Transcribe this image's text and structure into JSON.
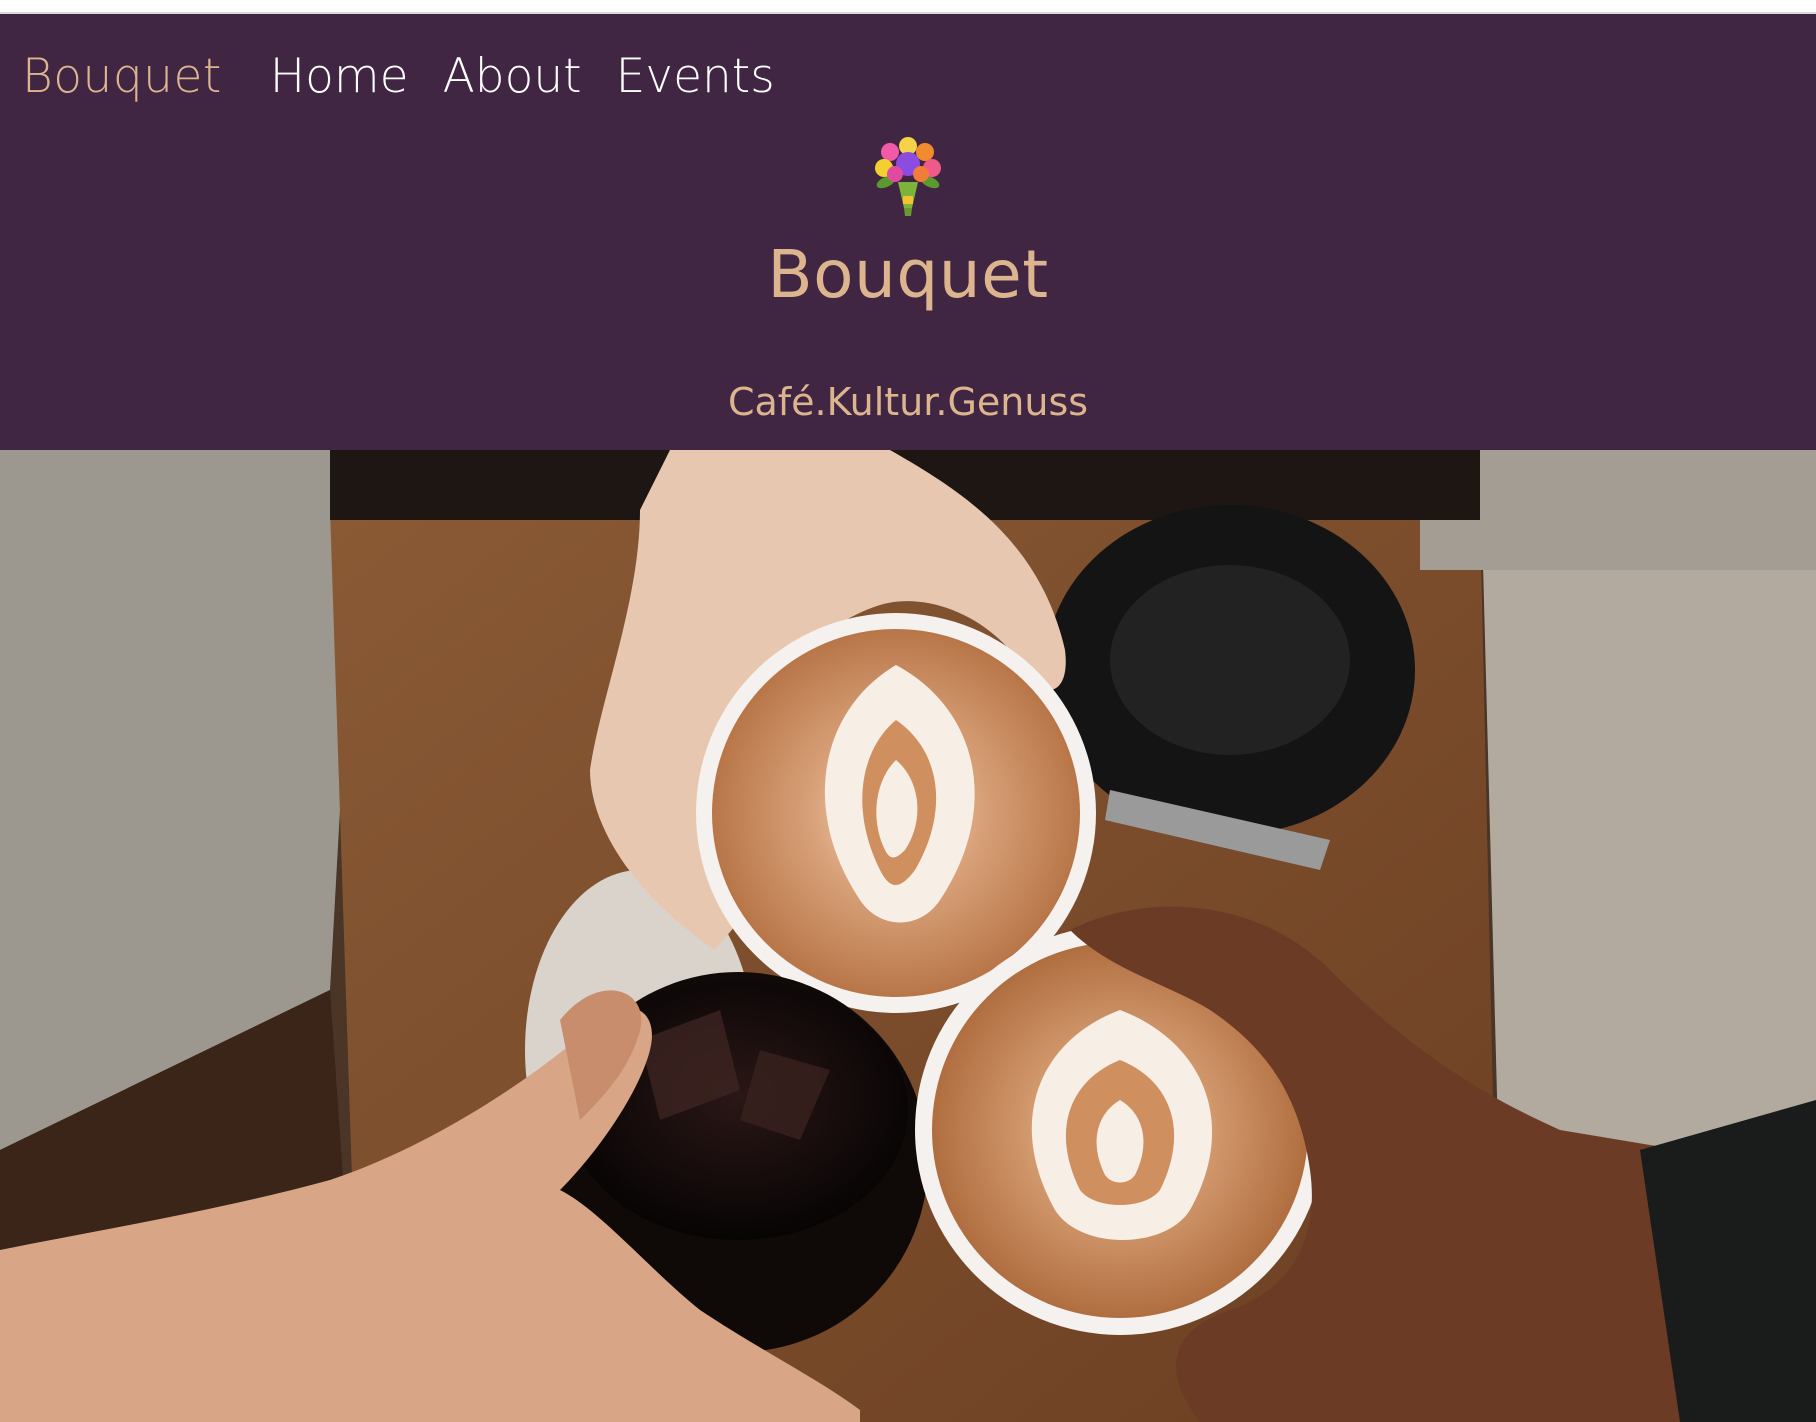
{
  "nav": {
    "brand": "Bouquet",
    "links": [
      "Home",
      "About",
      "Events"
    ]
  },
  "hero": {
    "logo_icon": "bouquet-emoji-icon",
    "title": "Bouquet",
    "subtitle": "Café.Kultur.Genuss"
  },
  "photo": {
    "subject": "hero-photo"
  },
  "colors": {
    "header_bg": "#412643",
    "accent": "#dcb58f",
    "nav_text": "#ffffff"
  }
}
